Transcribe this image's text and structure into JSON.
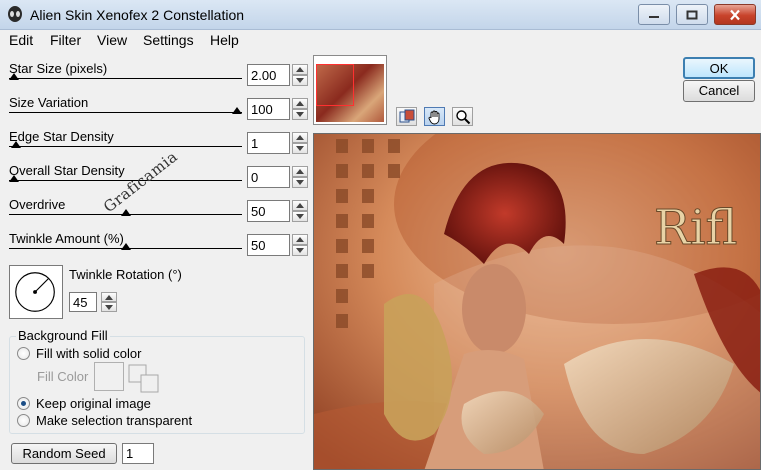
{
  "window": {
    "title": "Alien Skin Xenofex 2 Constellation"
  },
  "menu": [
    "Edit",
    "Filter",
    "View",
    "Settings",
    "Help"
  ],
  "sliders": [
    {
      "label": "Star Size (pixels)",
      "value": "2.00",
      "level": 0.0
    },
    {
      "label": "Size Variation",
      "value": "100",
      "level": 1.0
    },
    {
      "label": "Edge Star Density",
      "value": "1",
      "level": 0.01
    },
    {
      "label": "Overall Star Density",
      "value": "0",
      "level": 0.0
    },
    {
      "label": "Overdrive",
      "value": "50",
      "level": 0.5
    },
    {
      "label": "Twinkle Amount (%)",
      "value": "50",
      "level": 0.5
    }
  ],
  "rotation": {
    "label": "Twinkle Rotation (°)",
    "value": "45"
  },
  "background_fill": {
    "title": "Background Fill",
    "options": [
      {
        "label": "Fill with solid color",
        "selected": false
      },
      {
        "label": "Keep original image",
        "selected": true
      },
      {
        "label": "Make selection transparent",
        "selected": false
      }
    ],
    "fill_color_label": "Fill Color"
  },
  "random_seed": {
    "button_label": "Random Seed",
    "value": "1"
  },
  "buttons": {
    "ok": "OK",
    "cancel": "Cancel"
  },
  "watermark": "Graficamia",
  "preview": {
    "overlay_text": "Rifl"
  },
  "colors": {
    "accent": "#3c7fb1",
    "close": "#c8432b",
    "preview_bg": "#c98050"
  }
}
